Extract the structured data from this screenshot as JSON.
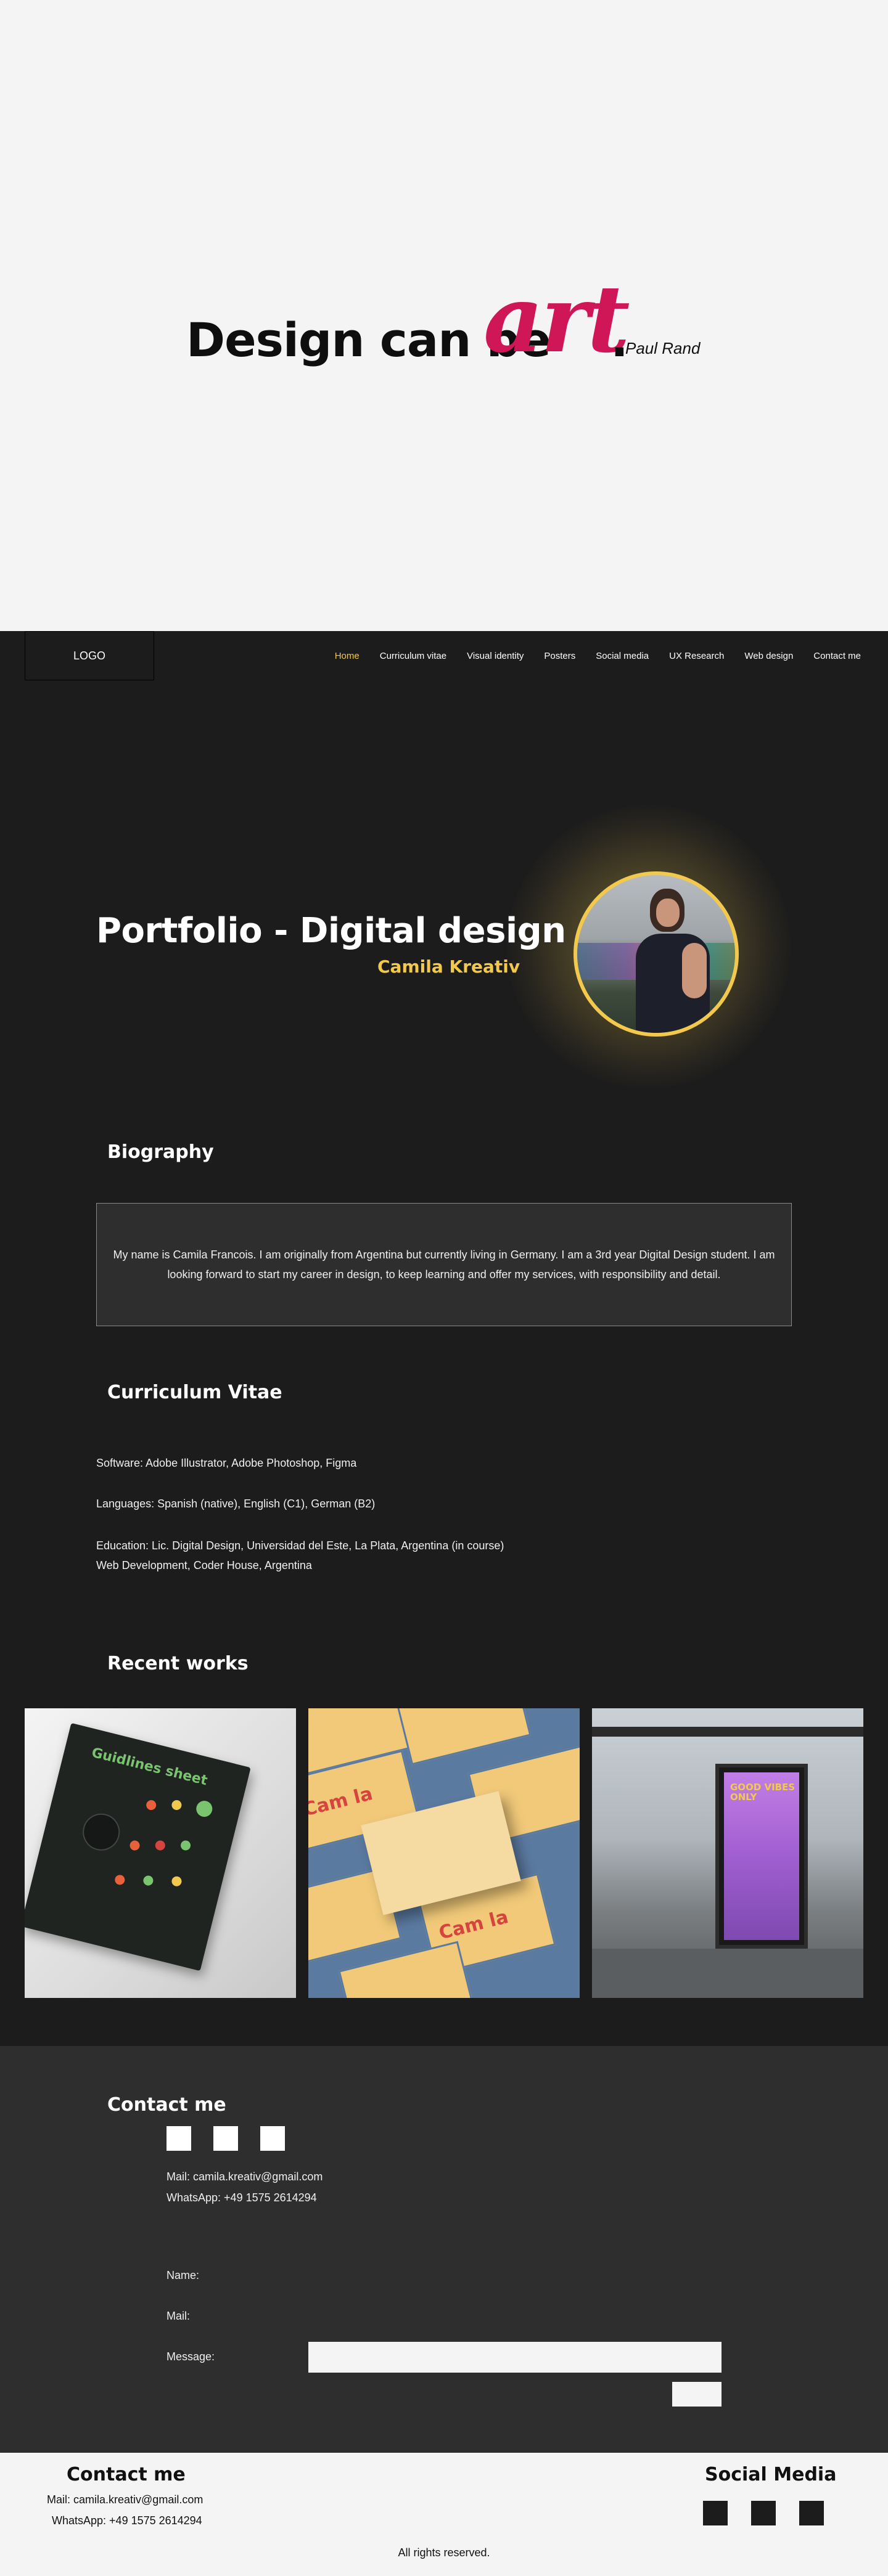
{
  "hero": {
    "text": "Design can be",
    "art": "art",
    "dot": ".",
    "author": "Paul Rand"
  },
  "nav": {
    "logo": "LOGO",
    "items": [
      "Home",
      "Curriculum vitae",
      "Visual identity",
      "Posters",
      "Social media",
      "UX Research",
      "Web design",
      "Contact me"
    ],
    "active": "Home"
  },
  "intro": {
    "title": "Portfolio - Digital design",
    "subtitle": "Camila Kreativ"
  },
  "biography": {
    "title": "Biography",
    "text": "My name is Camila Francois. I am originally from Argentina but currently living in Germany. I am a 3rd year Digital Design student. I am looking forward to start my career in design, to keep learning and offer my services, with responsibility and detail."
  },
  "cv": {
    "title": "Curriculum Vitae",
    "software": "Software: Adobe Illustrator, Adobe Photoshop, Figma",
    "languages": "Languages: Spanish (native), English (C1), German (B2)",
    "education_1": "Education: Lic. Digital Design, Universidad del Este, La Plata, Argentina (in course)",
    "education_2": "Web Development, Coder House, Argentina"
  },
  "works": {
    "title": "Recent works",
    "poster_title": "Guidlines sheet",
    "card_logo": "Cam la",
    "billboard_text": "GOOD VIBES ONLY"
  },
  "contact": {
    "title": "Contact me",
    "mail": "Mail: camila.kreativ@gmail.com",
    "whatsapp": "WhatsApp: +49 1575 2614294",
    "name_label": "Name:",
    "mail_label": "Mail:",
    "message_label": "Message:"
  },
  "footer": {
    "contact_title": "Contact me",
    "mail": "Mail: camila.kreativ@gmail.com",
    "whatsapp": "WhatsApp: +49 1575 2614294",
    "social_title": "Social Media",
    "rights": "All rights reserved."
  },
  "colors": {
    "accent_yellow": "#f2c94c",
    "art_magenta": "#cf1657",
    "dark_bg": "#1c1c1c",
    "contact_bg": "#2e2e2e"
  }
}
